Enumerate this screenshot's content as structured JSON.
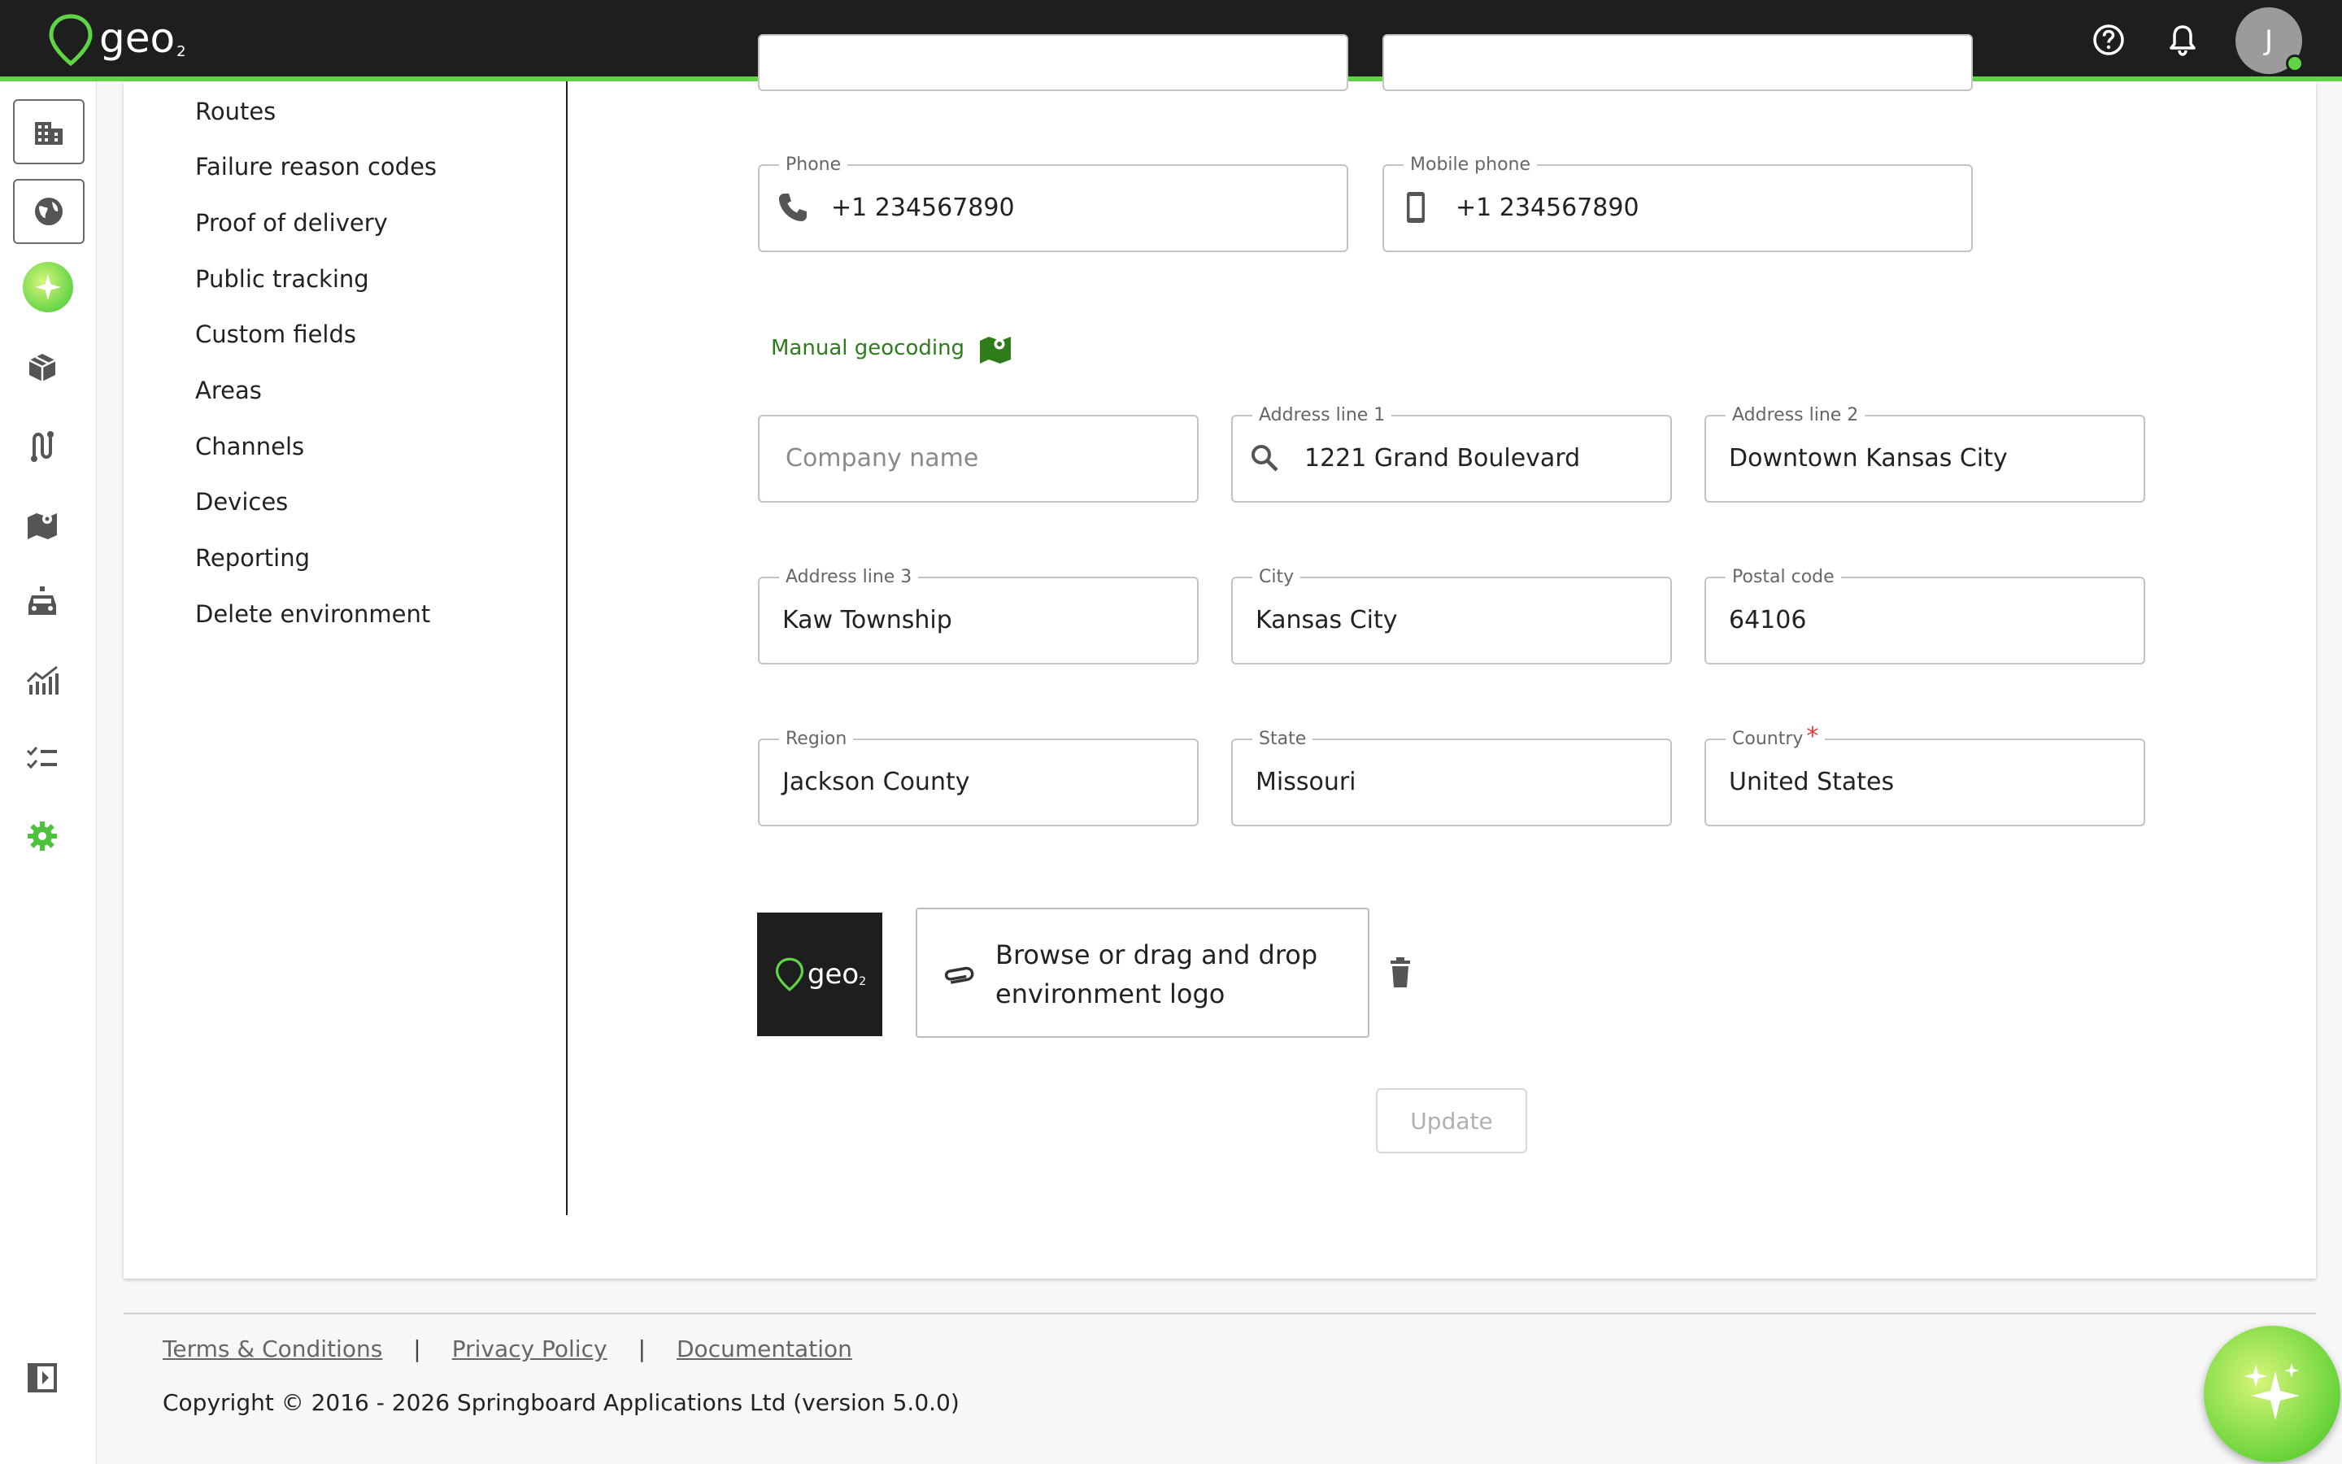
{
  "app": {
    "logo_text": "geo",
    "logo_sub": "2",
    "avatar_initial": "J",
    "accent": "#5fd444"
  },
  "topbar": {
    "icons": [
      "help-icon",
      "bell-icon"
    ]
  },
  "rail": {
    "items": [
      "building-icon",
      "globe-icon",
      "ai-sparkle-icon",
      "package-icon",
      "route-icon",
      "map-icon",
      "vehicle-icon",
      "analytics-icon",
      "checklist-icon",
      "settings-icon",
      "collapse-sidebar-icon"
    ]
  },
  "submenu": {
    "items": [
      "Routes",
      "Failure reason codes",
      "Proof of delivery",
      "Public tracking",
      "Custom fields",
      "Areas",
      "Channels",
      "Devices",
      "Reporting",
      "Delete environment"
    ]
  },
  "form": {
    "phone": {
      "label": "Phone",
      "value": "+1 234567890"
    },
    "mobile": {
      "label": "Mobile phone",
      "value": "+1 234567890"
    },
    "manual_geocoding": "Manual geocoding",
    "company": {
      "placeholder": "Company name"
    },
    "address1": {
      "label": "Address line 1",
      "value": "1221 Grand Boulevard"
    },
    "address2": {
      "label": "Address line 2",
      "value": "Downtown Kansas City"
    },
    "address3": {
      "label": "Address line 3",
      "value": "Kaw Township"
    },
    "city": {
      "label": "City",
      "value": "Kansas City"
    },
    "postal": {
      "label": "Postal code",
      "value": "64106"
    },
    "region": {
      "label": "Region",
      "value": "Jackson County"
    },
    "state": {
      "label": "State",
      "value": "Missouri"
    },
    "country": {
      "label": "Country",
      "required_mark": "*",
      "value": "United States"
    },
    "upload_label": "Browse or drag and drop environment logo",
    "update_label": "Update"
  },
  "footer": {
    "terms": "Terms & Conditions",
    "privacy": "Privacy Policy",
    "docs": "Documentation",
    "separator": "|",
    "copyright": "Copyright © 2016 - 2026 Springboard Applications Ltd (version 5.0.0)"
  }
}
